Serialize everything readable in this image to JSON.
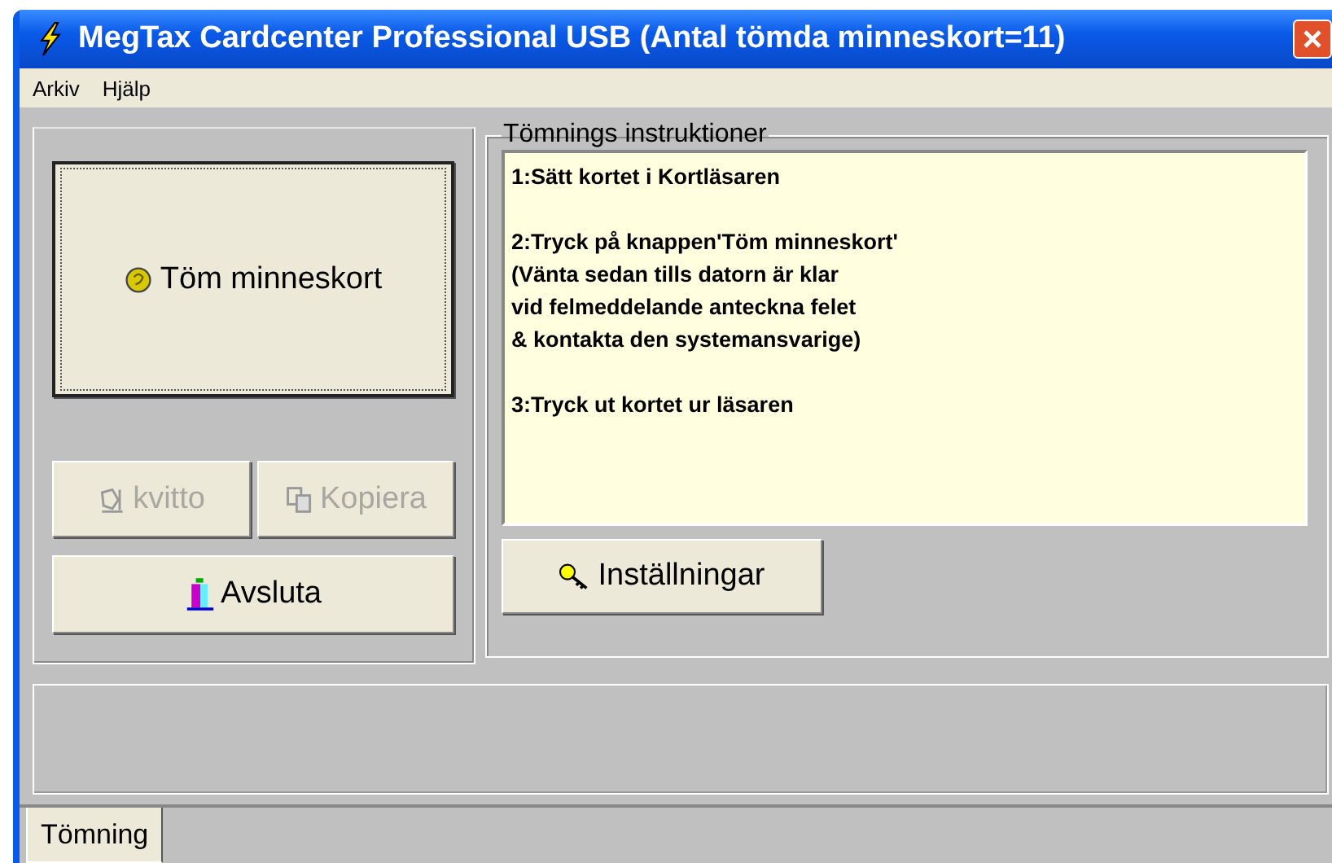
{
  "window": {
    "title": "MegTax Cardcenter Professional USB (Antal tömda minneskort=11)"
  },
  "menu": [
    "Arkiv",
    "Hjälp"
  ],
  "actions": [
    {
      "kind": "main",
      "label": "Töm minneskort",
      "disabled": false
    },
    {
      "kind": "receipt",
      "label": "kvitto",
      "disabled": true
    },
    {
      "kind": "copy",
      "label": "Kopiera",
      "disabled": true
    },
    {
      "kind": "exit",
      "label": "Avsluta",
      "disabled": false
    }
  ],
  "instructions": {
    "title": "Tömnings instruktioner",
    "paragraphs": [
      [
        "1:Sätt kortet i Kortläsaren"
      ],
      [
        "2:Tryck på knappen'Töm minneskort'",
        "(Vänta sedan tills datorn är klar",
        "vid felmeddelande anteckna felet",
        "& kontakta den systemansvarige)"
      ],
      [
        "3:Tryck ut kortet ur läsaren"
      ]
    ]
  },
  "settings_button": "Inställningar",
  "tabs": [
    {
      "label": "Tömning",
      "selected": true
    }
  ]
}
